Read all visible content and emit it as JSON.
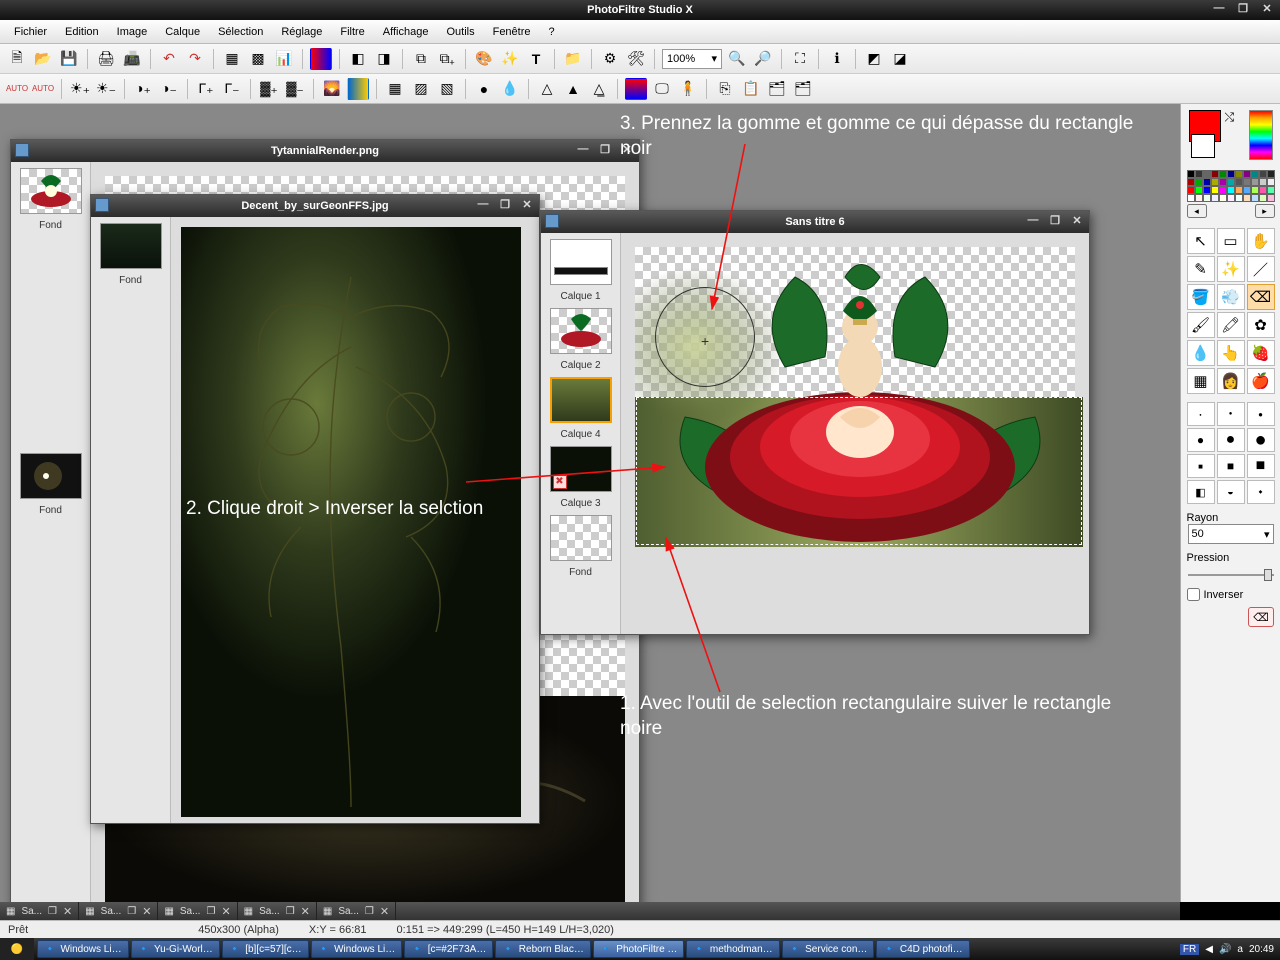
{
  "app": {
    "title": "PhotoFiltre Studio X"
  },
  "menu": [
    "Fichier",
    "Edition",
    "Image",
    "Calque",
    "Sélection",
    "Réglage",
    "Filtre",
    "Affichage",
    "Outils",
    "Fenêtre",
    "?"
  ],
  "zoom": "100%",
  "windows": {
    "a": {
      "title": "TytannialRender.png",
      "layers": [
        {
          "label": "Fond"
        },
        {
          "label": "Fond"
        }
      ]
    },
    "b": {
      "title": "Decent_by_surGeonFFS.jpg",
      "layers": [
        {
          "label": "Fond"
        }
      ]
    },
    "c": {
      "title": "Sans titre 6",
      "layers": [
        {
          "label": "Calque 1"
        },
        {
          "label": "Calque 2"
        },
        {
          "label": "Calque 4",
          "selected": true
        },
        {
          "label": "Calque 3"
        },
        {
          "label": "Fond"
        }
      ]
    }
  },
  "annot": {
    "s1": "1. Avec l'outil de selection rectangulaire suiver le rectangle noire",
    "s2": "2. Clique droit > Inverser la selction",
    "s3": "3. Prennez la gomme et gomme ce qui dépasse du rectangle noir"
  },
  "params": {
    "rayon_label": "Rayon",
    "rayon_value": "50",
    "pression_label": "Pression",
    "inverser_label": "Inverser"
  },
  "status": {
    "ready": "Prêt",
    "dim": "450x300 (Alpha)",
    "xy": "X:Y = 66:81",
    "sel": "0:151 => 449:299 (L=450  H=149  L/H=3,020)"
  },
  "doctab_label": "Sa...",
  "taskbar": {
    "items": [
      "Windows Li…",
      "Yu-Gi-Worl…",
      "[b][c=57][c…",
      "Windows Li…",
      "[c=#2F73A…",
      "Reborn Blac…",
      "PhotoFiltre …",
      "methodman…",
      "Service con…",
      "C4D photofi…"
    ],
    "lang": "FR",
    "clock": "20:49"
  },
  "palette_colors": [
    "#000",
    "#333",
    "#666",
    "#800",
    "#080",
    "#008",
    "#880",
    "#808",
    "#088",
    "#444",
    "#222",
    "#a00",
    "#0a0",
    "#00a",
    "#aa0",
    "#a0a",
    "#0aa",
    "#555",
    "#777",
    "#999",
    "#ccc",
    "#eee",
    "#f00",
    "#0f0",
    "#00f",
    "#ff0",
    "#f0f",
    "#0ff",
    "#fa5",
    "#5af",
    "#af5",
    "#f5a",
    "#5fa",
    "#fff",
    "#fee",
    "#efe",
    "#eef",
    "#ffe",
    "#fef",
    "#eff",
    "#fdb",
    "#bdf",
    "#dfb",
    "#fbd"
  ]
}
